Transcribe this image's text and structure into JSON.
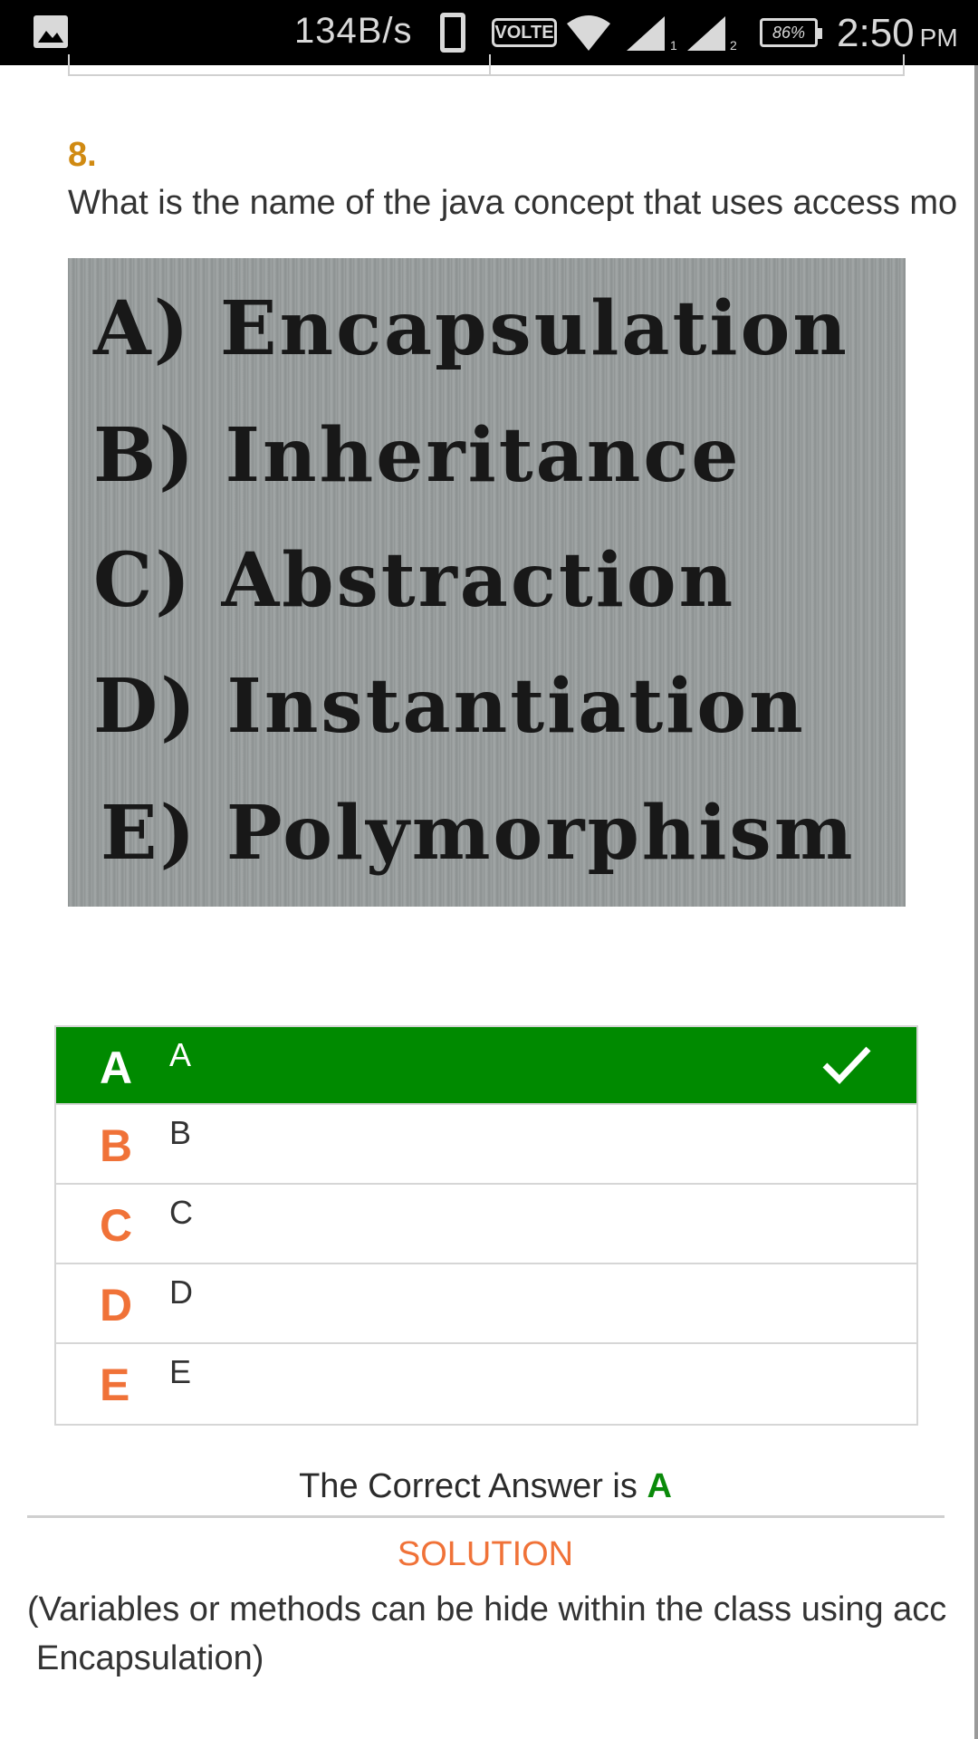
{
  "status_bar": {
    "net_speed": "134B/s",
    "volte": "VOLTE",
    "sim1": "1",
    "sim2": "2",
    "battery": "86%",
    "time": "2:50",
    "ampm": "PM"
  },
  "question": {
    "number": "8.",
    "text": "What is the name of the java concept that uses access mo",
    "image_options": [
      "A) Encapsulation",
      "B) Inheritance",
      "C) Abstraction",
      "D) Instantiation",
      "E) Polymorphism"
    ]
  },
  "options": [
    {
      "letter": "A",
      "text": "A"
    },
    {
      "letter": "B",
      "text": "B"
    },
    {
      "letter": "C",
      "text": "C"
    },
    {
      "letter": "D",
      "text": "D"
    },
    {
      "letter": "E",
      "text": "E"
    }
  ],
  "result": {
    "prefix": "The Correct Answer is",
    "answer": "A"
  },
  "solution": {
    "title": "SOLUTION",
    "line1": "(Variables or methods can be hide within the class using acc",
    "line2": "Encapsulation)"
  },
  "colors": {
    "selected": "#008a00",
    "accent": "#f07238",
    "question_number": "#d08a12"
  }
}
